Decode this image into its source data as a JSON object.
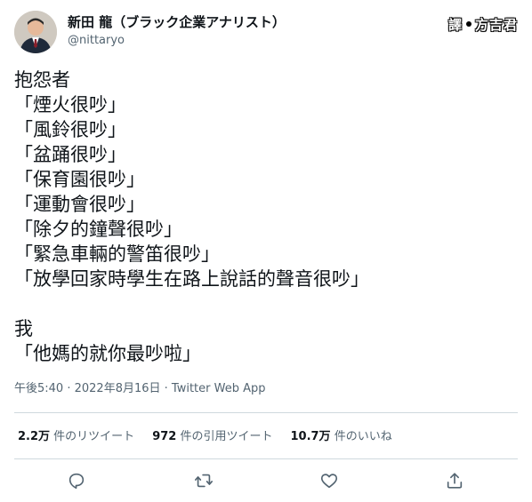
{
  "author": {
    "display_name": "新田 龍（ブラック企業アナリスト）",
    "handle": "@nittaryo"
  },
  "translator_badge": {
    "left": "譯",
    "right": "方吉君"
  },
  "tweet": {
    "lines": [
      "抱怨者",
      "「煙火很吵」",
      "「風鈴很吵」",
      "「盆踊很吵」",
      "「保育園很吵」",
      "「運動會很吵」",
      "「除夕的鐘聲很吵」",
      "「緊急車輛的警笛很吵」",
      "「放學回家時學生在路上說話的聲音很吵」",
      "",
      "我",
      "「他媽的就你最吵啦」"
    ]
  },
  "meta": {
    "time": "午後5:40",
    "separator1": " · ",
    "date": "2022年8月16日",
    "separator2": " · ",
    "source": "Twitter Web App"
  },
  "stats": {
    "retweets": {
      "count": "2.2万",
      "label": "件のリツイート"
    },
    "quotes": {
      "count": "972",
      "label": "件の引用ツイート"
    },
    "likes": {
      "count": "10.7万",
      "label": "件のいいね"
    }
  },
  "actions": [
    "reply-icon",
    "retweet-icon",
    "like-icon",
    "share-icon"
  ],
  "colors": {
    "text": "#0f1419",
    "secondary": "#536471",
    "divider": "#cfd9de"
  }
}
